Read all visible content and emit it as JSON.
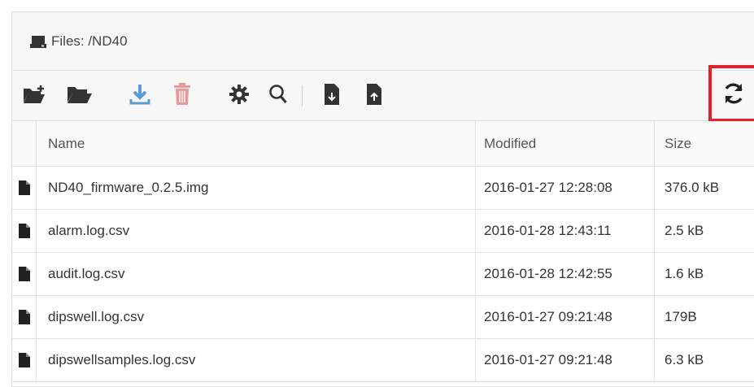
{
  "header": {
    "title": "Files: /ND40"
  },
  "columns": {
    "name": "Name",
    "modified": "Modified",
    "size": "Size"
  },
  "files": [
    {
      "name": "ND40_firmware_0.2.5.img",
      "modified": "2016-01-27 12:28:08",
      "size": "376.0 kB"
    },
    {
      "name": "alarm.log.csv",
      "modified": "2016-01-28 12:43:11",
      "size": "2.5 kB"
    },
    {
      "name": "audit.log.csv",
      "modified": "2016-01-28 12:42:55",
      "size": "1.6 kB"
    },
    {
      "name": "dipswell.log.csv",
      "modified": "2016-01-27 09:21:48",
      "size": "179B"
    },
    {
      "name": "dipswellsamples.log.csv",
      "modified": "2016-01-27 09:21:48",
      "size": "6.3 kB"
    }
  ],
  "icons": {
    "title": "hdd-icon",
    "new_folder": "folder-open-plus-icon",
    "open_folder": "folder-open-icon",
    "download": "download-icon",
    "delete": "trash-icon",
    "settings": "gear-icon",
    "search": "search-icon",
    "file_download": "file-download-icon",
    "file_upload": "file-upload-icon",
    "refresh": "refresh-icon",
    "file": "file-icon"
  },
  "colors": {
    "download": "#5b9bd5",
    "delete": "#e89a9a",
    "highlight": "#e0202a",
    "icon_dark": "#333333"
  }
}
